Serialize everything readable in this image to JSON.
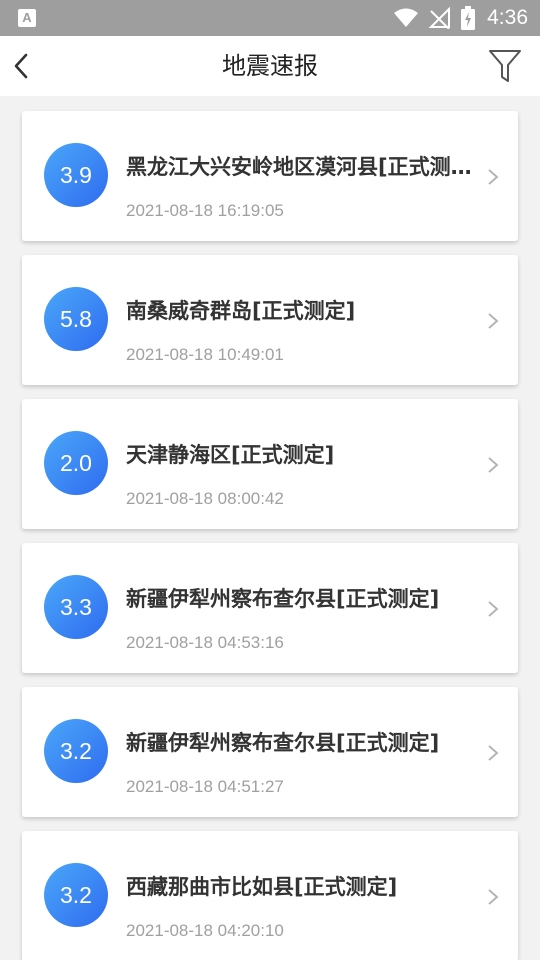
{
  "status_bar": {
    "app_icon_letter": "A",
    "time": "4:36",
    "icons": [
      "wifi-icon",
      "no-signal-icon",
      "battery-charging-icon"
    ]
  },
  "header": {
    "title": "地震速报",
    "back_icon": "back-arrow-icon",
    "filter_icon": "filter-icon"
  },
  "colors": {
    "badge_gradient_start": "#4aa8f8",
    "badge_gradient_end": "#2f6bf0",
    "status_bar": "#9e9e9e",
    "background": "#f2f2f2"
  },
  "earthquakes": [
    {
      "magnitude": "3.9",
      "location": "黑龙江大兴安岭地区漠河县[正式测定]",
      "time": "2021-08-18 16:19:05"
    },
    {
      "magnitude": "5.8",
      "location": "南桑威奇群岛[正式测定]",
      "time": "2021-08-18 10:49:01"
    },
    {
      "magnitude": "2.0",
      "location": "天津静海区[正式测定]",
      "time": "2021-08-18 08:00:42"
    },
    {
      "magnitude": "3.3",
      "location": "新疆伊犁州察布查尔县[正式测定]",
      "time": "2021-08-18 04:53:16"
    },
    {
      "magnitude": "3.2",
      "location": "新疆伊犁州察布查尔县[正式测定]",
      "time": "2021-08-18 04:51:27"
    },
    {
      "magnitude": "3.2",
      "location": "西藏那曲市比如县[正式测定]",
      "time": "2021-08-18 04:20:10"
    }
  ]
}
